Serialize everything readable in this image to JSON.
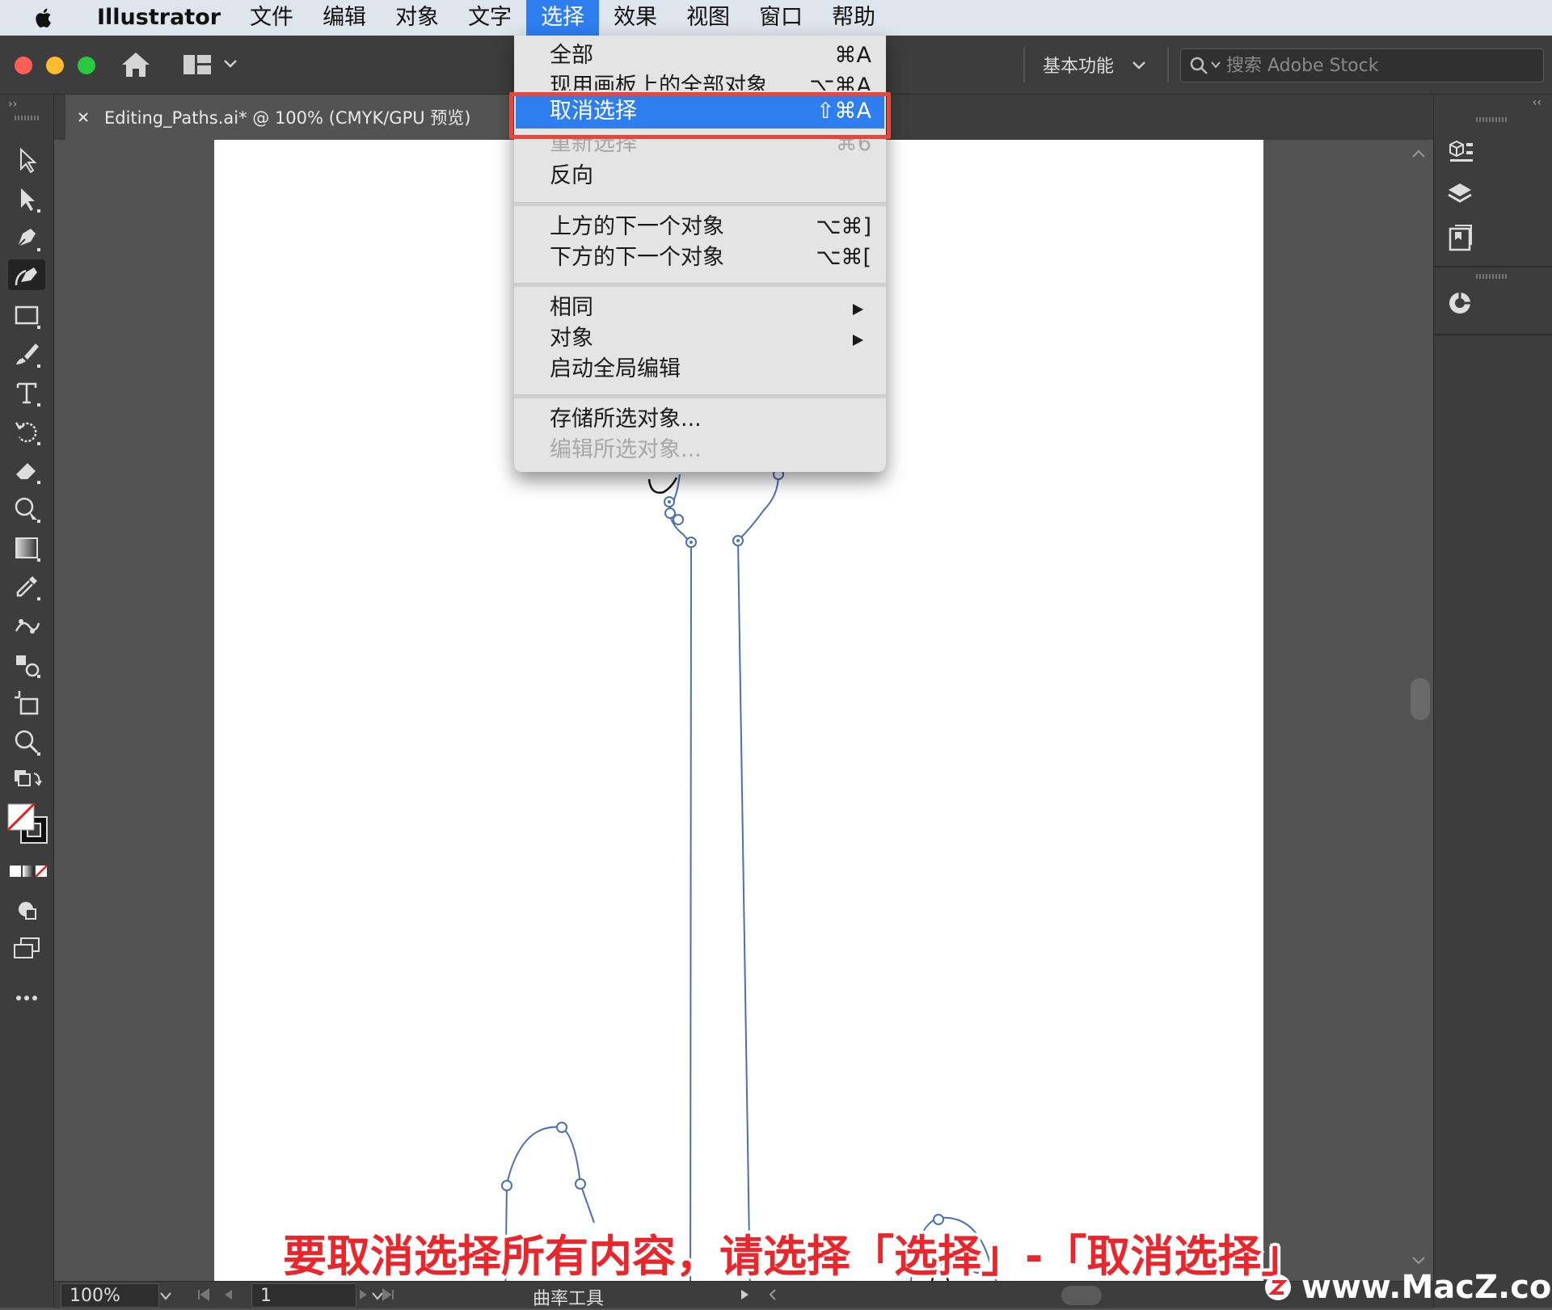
{
  "menubar": {
    "app": "Illustrator",
    "items": [
      "文件",
      "编辑",
      "对象",
      "文字",
      "选择",
      "效果",
      "视图",
      "窗口",
      "帮助"
    ],
    "active": "选择"
  },
  "header": {
    "workspace": "基本功能",
    "search_placeholder": "搜索 Adobe Stock"
  },
  "document": {
    "tab_title": "Editing_Paths.ai* @ 100% (CMYK/GPU 预览)"
  },
  "select_menu": {
    "items": [
      {
        "label": "全部",
        "shortcut": "⌘A"
      },
      {
        "label": "现用画板上的全部对象",
        "shortcut": "⌥⌘A"
      },
      {
        "label": "取消选择",
        "shortcut": "⇧⌘A",
        "highlighted": true
      },
      {
        "label": "重新选择",
        "shortcut": "⌘6",
        "disabled": true
      },
      {
        "label": "反向",
        "shortcut": ""
      },
      {
        "label": "上方的下一个对象",
        "shortcut": "⌥⌘]"
      },
      {
        "label": "下方的下一个对象",
        "shortcut": "⌥⌘["
      },
      {
        "label": "相同",
        "shortcut": ""
      },
      {
        "label": "对象",
        "shortcut": ""
      },
      {
        "label": "启动全局编辑",
        "shortcut": ""
      },
      {
        "label": "存储所选对象...",
        "shortcut": ""
      },
      {
        "label": "编辑所选对象...",
        "shortcut": "",
        "disabled": true
      }
    ]
  },
  "statusbar": {
    "zoom": "100%",
    "page": "1",
    "tool_name": "曲率工具"
  },
  "caption": "要取消选择所有内容，请选择「选择」-「取消选择」",
  "watermark": "www.MacZ.com",
  "colors": {
    "menu_highlight": "#2e7ef0",
    "callout_box": "#e8453c",
    "caption": "#e8262c",
    "path_stroke": "#4a6fb5"
  }
}
